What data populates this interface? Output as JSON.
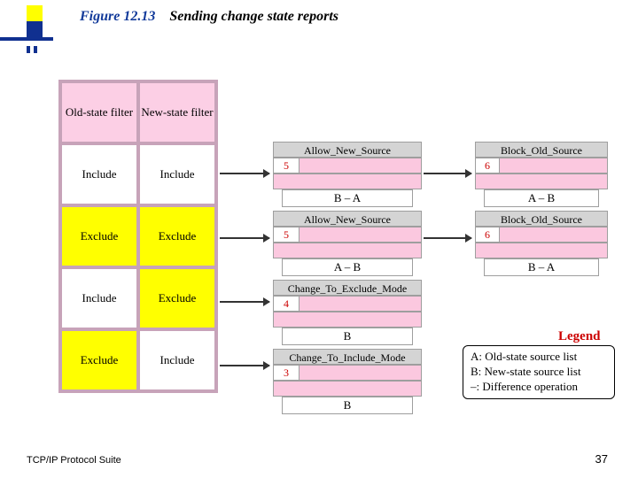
{
  "figure": {
    "number": "Figure 12.13",
    "caption": "Sending change state reports"
  },
  "table": {
    "header": {
      "old": "Old-state filter",
      "new": "New-state filter"
    },
    "rows": [
      {
        "old": "Include",
        "new": "Include",
        "old_bg": "white",
        "new_bg": "white"
      },
      {
        "old": "Exclude",
        "new": "Exclude",
        "old_bg": "yellow",
        "new_bg": "yellow"
      },
      {
        "old": "Include",
        "new": "Exclude",
        "old_bg": "white",
        "new_bg": "yellow"
      },
      {
        "old": "Exclude",
        "new": "Include",
        "old_bg": "yellow",
        "new_bg": "white"
      }
    ]
  },
  "messages": {
    "r1_allow": {
      "title": "Allow_New_Source",
      "num": "5",
      "data": "B – A"
    },
    "r1_block": {
      "title": "Block_Old_Source",
      "num": "6",
      "data": "A – B"
    },
    "r2_allow": {
      "title": "Allow_New_Source",
      "num": "5",
      "data": "A – B"
    },
    "r2_block": {
      "title": "Block_Old_Source",
      "num": "6",
      "data": "B – A"
    },
    "r3_change": {
      "title": "Change_To_Exclude_Mode",
      "num": "4",
      "data": "B"
    },
    "r4_change": {
      "title": "Change_To_Include_Mode",
      "num": "3",
      "data": "B"
    }
  },
  "legend": {
    "heading": "Legend",
    "lineA": "A: Old-state source list",
    "lineB": "B: New-state source list",
    "lineC": "–: Difference operation"
  },
  "footer": {
    "left": "TCP/IP Protocol Suite",
    "right": "37"
  }
}
